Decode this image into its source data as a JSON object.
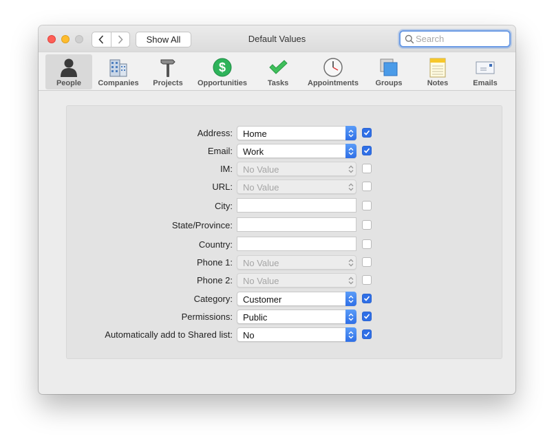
{
  "window": {
    "title": "Default Values"
  },
  "nav": {
    "show_all_label": "Show All"
  },
  "search": {
    "placeholder": "Search",
    "value": ""
  },
  "toolbar": {
    "items": [
      {
        "label": "People",
        "icon": "person-icon",
        "selected": true
      },
      {
        "label": "Companies",
        "icon": "building-icon",
        "selected": false
      },
      {
        "label": "Projects",
        "icon": "hammer-icon",
        "selected": false
      },
      {
        "label": "Opportunities",
        "icon": "dollar-icon",
        "selected": false
      },
      {
        "label": "Tasks",
        "icon": "checkmark-icon",
        "selected": false
      },
      {
        "label": "Appointments",
        "icon": "clock-icon",
        "selected": false
      },
      {
        "label": "Groups",
        "icon": "groups-icon",
        "selected": false
      },
      {
        "label": "Notes",
        "icon": "notepad-icon",
        "selected": false
      },
      {
        "label": "Emails",
        "icon": "envelope-icon",
        "selected": false
      }
    ]
  },
  "fields": [
    {
      "label": "Address:",
      "type": "select",
      "value": "Home",
      "enabled": true,
      "checked": true
    },
    {
      "label": "Email:",
      "type": "select",
      "value": "Work",
      "enabled": true,
      "checked": true
    },
    {
      "label": "IM:",
      "type": "select",
      "value": "No Value",
      "enabled": false,
      "checked": false
    },
    {
      "label": "URL:",
      "type": "select",
      "value": "No Value",
      "enabled": false,
      "checked": false
    },
    {
      "label": "City:",
      "type": "text",
      "value": "",
      "enabled": true,
      "checked": false
    },
    {
      "label": "State/Province:",
      "type": "text",
      "value": "",
      "enabled": true,
      "checked": false
    },
    {
      "label": "Country:",
      "type": "text",
      "value": "",
      "enabled": true,
      "checked": false
    },
    {
      "label": "Phone 1:",
      "type": "select",
      "value": "No Value",
      "enabled": false,
      "checked": false
    },
    {
      "label": "Phone 2:",
      "type": "select",
      "value": "No Value",
      "enabled": false,
      "checked": false
    },
    {
      "label": "Category:",
      "type": "select",
      "value": "Customer",
      "enabled": true,
      "checked": true
    },
    {
      "label": "Permissions:",
      "type": "select",
      "value": "Public",
      "enabled": true,
      "checked": true
    },
    {
      "label": "Automatically add to Shared list:",
      "type": "select",
      "value": "No",
      "enabled": true,
      "checked": true
    }
  ],
  "colors": {
    "accent": "#2f6fe6",
    "close": "#fe5f57",
    "minimize": "#febc2e",
    "zoom": "#cfcfcf"
  }
}
